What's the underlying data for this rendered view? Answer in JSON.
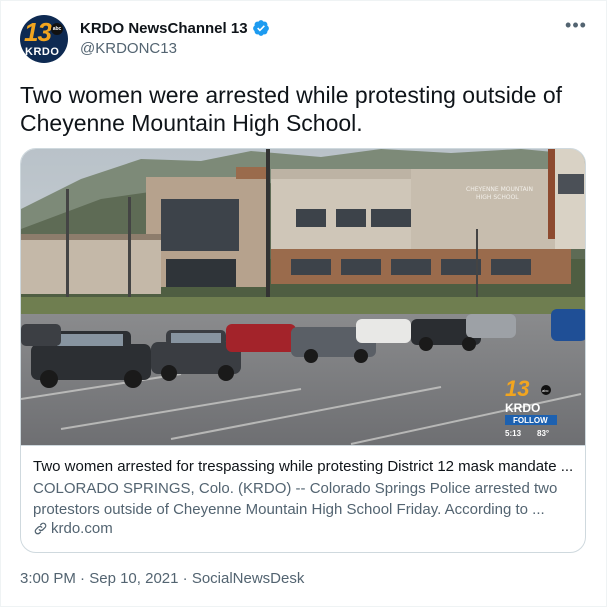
{
  "account": {
    "display_name": "KRDO NewsChannel 13",
    "handle": "@KRDONC13",
    "avatar": {
      "number": "13",
      "network": "abc",
      "brand": "KRDO"
    },
    "verified_icon": "verified-badge-icon",
    "more_icon": "more-options-icon"
  },
  "tweet": {
    "text": "Two women were arrested while protesting outside of Cheyenne Mountain High School."
  },
  "card": {
    "image": {
      "building_sign_line1": "CHEYENNE MOUNTAIN",
      "building_sign_line2": "HIGH SCHOOL",
      "bug_number": "13",
      "bug_network": "abc",
      "bug_brand": "KRDO",
      "bug_follow": "FOLLOW",
      "bug_time": "5:13",
      "bug_temp": "83°"
    },
    "title": "Two women arrested for trespassing while protesting District 12 mask mandate ...",
    "description": "COLORADO SPRINGS, Colo. (KRDO) -- Colorado Springs Police arrested two protestors outside of Cheyenne Mountain High School Friday. According to ...",
    "domain": "krdo.com",
    "link_icon": "link-icon"
  },
  "meta": {
    "time": "3:00 PM",
    "separator": " · ",
    "date": "Sep 10, 2021",
    "source": "SocialNewsDesk"
  },
  "colors": {
    "text_primary": "#0f1419",
    "text_secondary": "#536471",
    "verified_blue": "#1d9bf0",
    "border": "#cfd9de",
    "brand_orange": "#f2a51f"
  }
}
